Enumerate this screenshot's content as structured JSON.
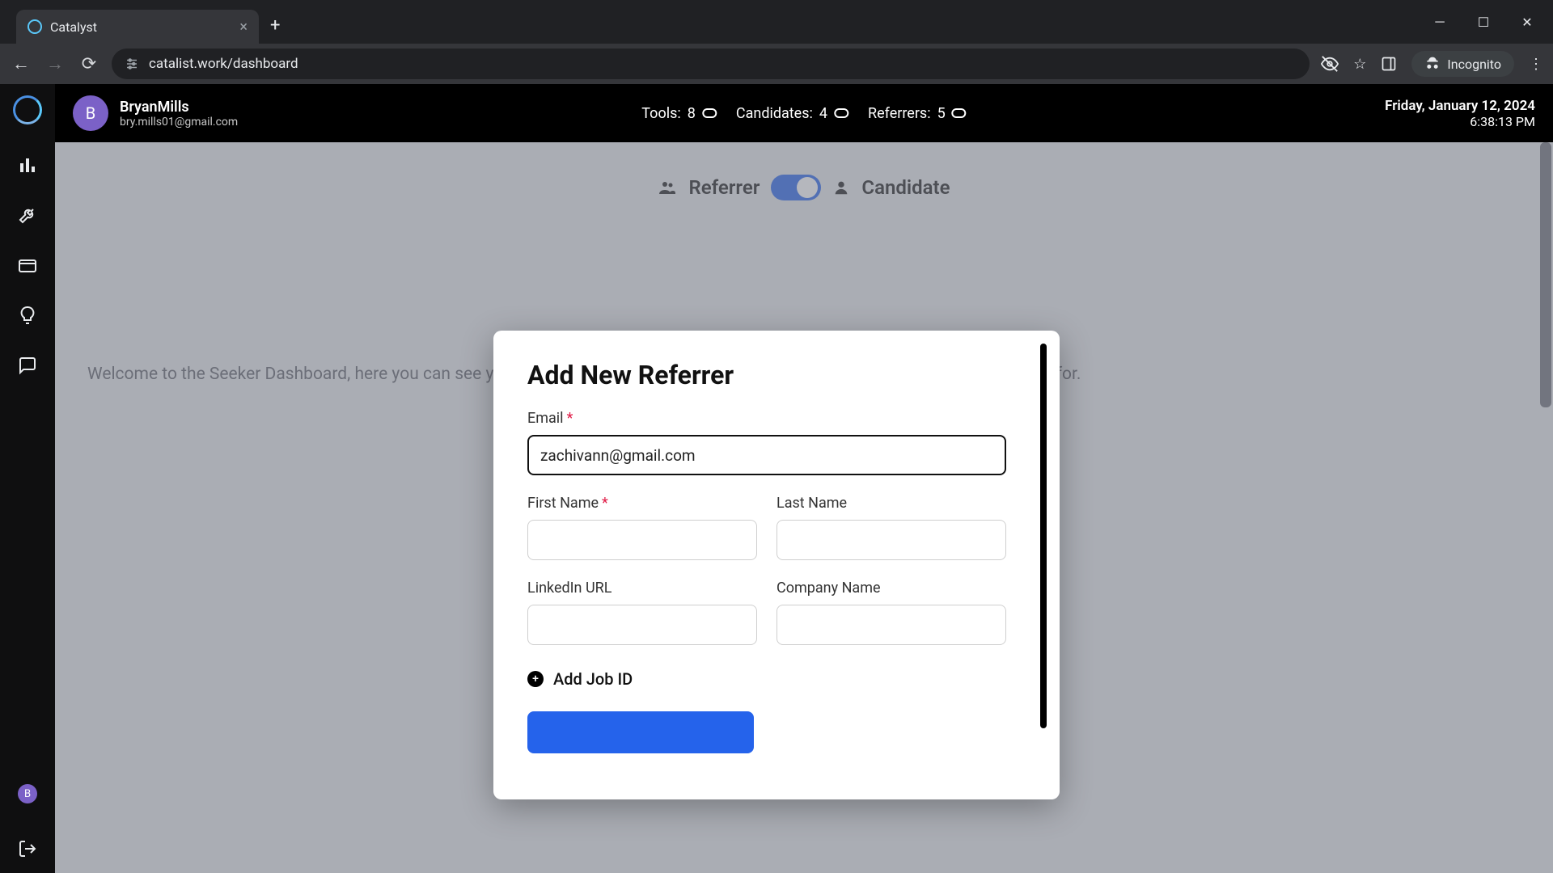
{
  "browser": {
    "tab_title": "Catalyst",
    "url": "catalist.work/dashboard",
    "incognito_label": "Incognito"
  },
  "header": {
    "avatar_letter": "B",
    "username": "BryanMills",
    "email": "bry.mills01@gmail.com",
    "stats": {
      "tools_label": "Tools:",
      "tools_value": "8",
      "candidates_label": "Candidates:",
      "candidates_value": "4",
      "referrers_label": "Referrers:",
      "referrers_value": "5"
    },
    "date": "Friday, January 12, 2024",
    "time": "6:38:13 PM"
  },
  "toggle": {
    "left_label": "Referrer",
    "right_label": "Candidate"
  },
  "welcome_text": "Welcome to the Seeker Dashboard, here you can see your latest referrer that you've added and jobs you have requested a referral for.",
  "modal": {
    "title": "Add New Referrer",
    "email_label": "Email",
    "email_value": "zachivann@gmail.com",
    "first_name_label": "First Name",
    "first_name_value": "",
    "last_name_label": "Last Name",
    "last_name_value": "",
    "linkedin_label": "LinkedIn URL",
    "linkedin_value": "",
    "company_label": "Company Name",
    "company_value": "",
    "add_job_label": "Add Job ID"
  },
  "rail_avatar_letter": "B"
}
